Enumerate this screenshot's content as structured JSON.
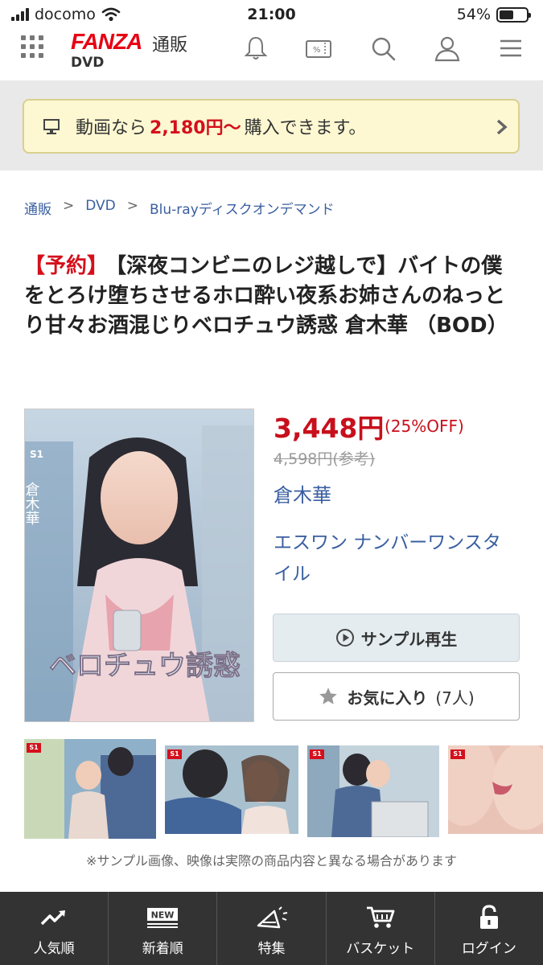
{
  "status_bar": {
    "carrier": "docomo",
    "time": "21:00",
    "battery_percent_text": "54%",
    "battery_level": 0.54
  },
  "header": {
    "logo": "FANZA",
    "logo_sub": "通販",
    "section": "DVD",
    "icons": [
      "grid-menu-icon",
      "bell-icon",
      "coupon-icon",
      "search-icon",
      "user-icon",
      "hamburger-icon"
    ]
  },
  "banner": {
    "prefix": "動画なら",
    "price": "2,180円〜",
    "suffix": "購入できます。"
  },
  "breadcrumb": [
    "通販",
    "DVD",
    "Blu-rayディスクオンデマンド"
  ],
  "breadcrumb_separator": ">",
  "product": {
    "tag": "【予約】",
    "title": "【深夜コンビニのレジ越しで】バイトの僕をとろけ堕ちさせるホロ酔い夜系お姉さんのねっとり甘々お酒混じりベロチュウ誘惑 倉木華 （BOD）",
    "price": "3,448円",
    "discount": "(25%OFF)",
    "original_price": "4,598円(参考)",
    "actress": "倉木華",
    "maker": "エスワン ナンバーワンスタイル",
    "sample_button": "サンプル再生",
    "favorite_label": "お気に入り",
    "favorite_count": "(7人)"
  },
  "cover_text": {
    "brand": "S1",
    "name": "倉木華",
    "title_big": "ベロチュウ誘惑"
  },
  "thumbnails_brand": "S1",
  "disclaimer": "※サンプル画像、映像は実際の商品内容と異なる場合があります",
  "tabbar": [
    {
      "label": "人気順",
      "icon": "trending-icon"
    },
    {
      "label": "新着順",
      "icon": "new-icon",
      "badge": "NEW"
    },
    {
      "label": "特集",
      "icon": "megaphone-icon"
    },
    {
      "label": "バスケット",
      "icon": "cart-icon"
    },
    {
      "label": "ログイン",
      "icon": "lock-icon"
    }
  ],
  "colors": {
    "brand_red": "#e60012",
    "price_red": "#c8101c",
    "link_blue": "#3a5fa0",
    "banner_bg": "#fdf8d2",
    "tabbar_bg": "#333333"
  }
}
